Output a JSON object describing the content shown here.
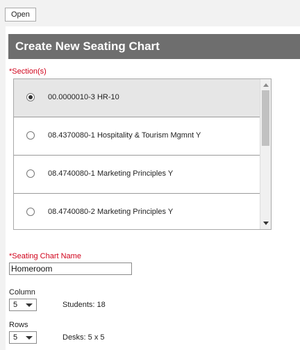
{
  "toolbar": {
    "open_label": "Open"
  },
  "header": {
    "title": "Create New Seating Chart"
  },
  "sections": {
    "label": "*Section(s)",
    "items": [
      {
        "label": "00.0000010-3 HR-10",
        "selected": true
      },
      {
        "label": "08.4370080-1 Hospitality & Tourism Mgmnt Y",
        "selected": false
      },
      {
        "label": "08.4740080-1 Marketing Principles Y",
        "selected": false
      },
      {
        "label": "08.4740080-2 Marketing Principles Y",
        "selected": false
      }
    ]
  },
  "seating_chart_name": {
    "label": "*Seating Chart Name",
    "value": "Homeroom"
  },
  "column": {
    "label": "Column",
    "value": "5"
  },
  "students": {
    "text": "Students: 18"
  },
  "rows": {
    "label": "Rows",
    "value": "5"
  },
  "desks": {
    "text": "Desks: 5 x 5"
  }
}
